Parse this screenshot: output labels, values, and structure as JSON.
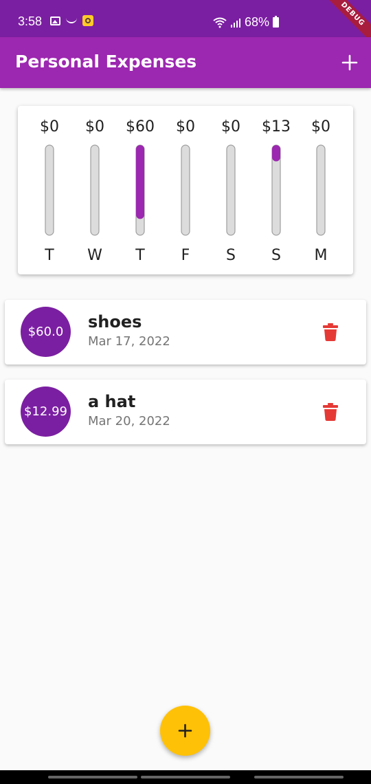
{
  "status_bar": {
    "time": "3:58",
    "battery": "68%",
    "icons": [
      "gallery-icon",
      "smile-icon",
      "app-notification-icon",
      "wifi-icon",
      "signal-icon",
      "battery-icon"
    ]
  },
  "debug_banner": "DEBUG",
  "app_bar": {
    "title": "Personal Expenses",
    "action_icon": "add-icon"
  },
  "chart_data": {
    "type": "bar",
    "categories": [
      "T",
      "W",
      "T",
      "F",
      "S",
      "S",
      "M"
    ],
    "values": [
      0,
      0,
      60,
      0,
      0,
      13,
      0
    ],
    "value_labels": [
      "$0",
      "$0",
      "$60",
      "$0",
      "$0",
      "$13",
      "$0"
    ],
    "max_fraction_basis": 73,
    "fill_fractions": [
      0,
      0,
      0.82,
      0,
      0,
      0.18,
      0
    ],
    "colors": {
      "fill": "#9c27b0",
      "track": "#dcdcdc",
      "track_border": "#9e9e9e"
    }
  },
  "transactions": [
    {
      "amount": "$60.0",
      "title": "shoes",
      "date": "Mar 17, 2022"
    },
    {
      "amount": "$12.99",
      "title": "a hat",
      "date": "Mar 20, 2022"
    }
  ],
  "fab": {
    "icon": "add-icon",
    "color": "#ffc107"
  },
  "colors": {
    "primary": "#9c27b0",
    "primary_dark": "#7b1fa2",
    "accent": "#ffc107",
    "delete": "#e53935"
  }
}
